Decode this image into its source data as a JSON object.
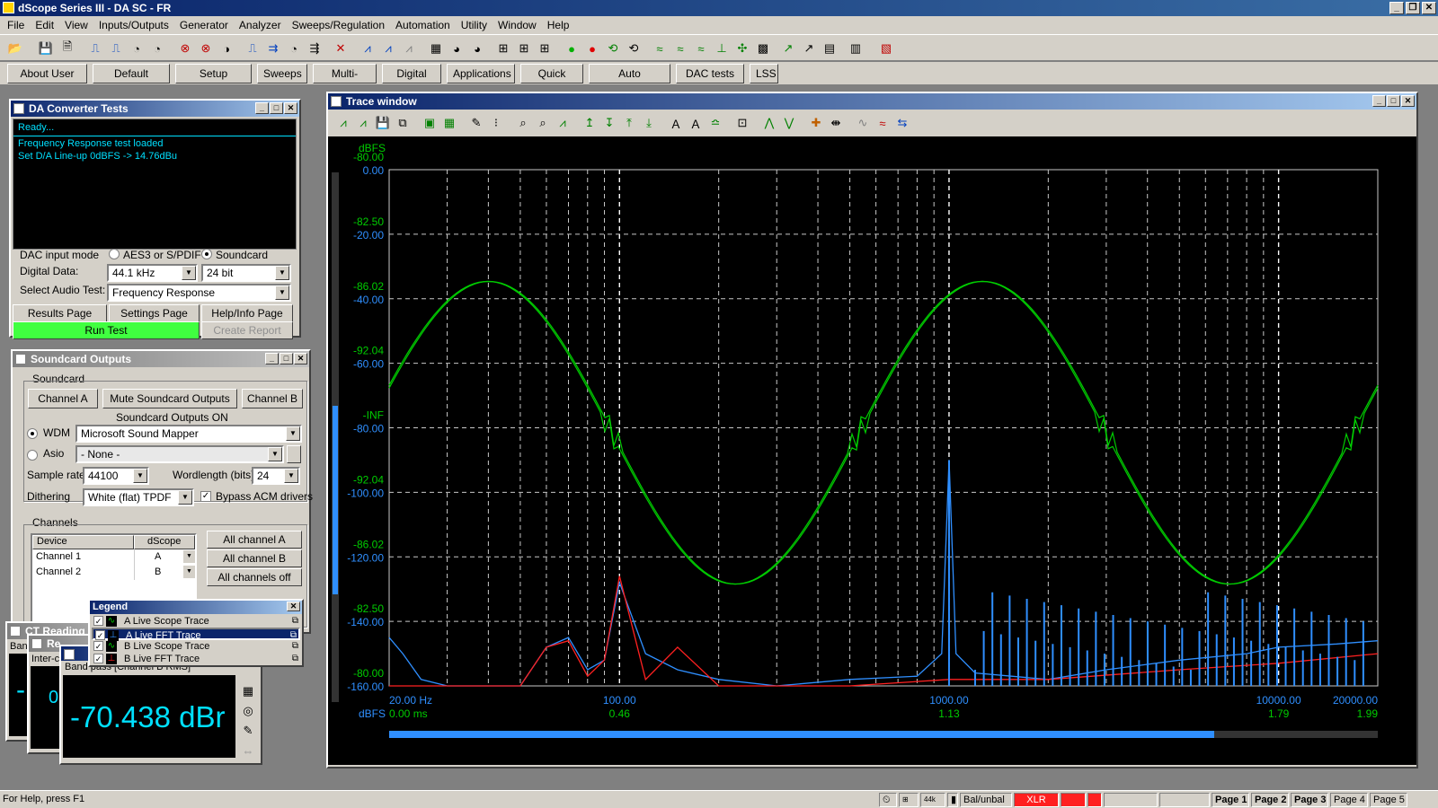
{
  "app": {
    "title": "dScope Series III - DA SC - FR"
  },
  "menu": [
    "File",
    "Edit",
    "View",
    "Inputs/Outputs",
    "Generator",
    "Analyzer",
    "Sweeps/Regulation",
    "Automation",
    "Utility",
    "Window",
    "Help"
  ],
  "user_bar": [
    "About User Bar",
    "Default Config",
    "Setup Wizard",
    "Sweeps",
    "Multi-tones",
    "Digital I/O",
    "Applications",
    "Quick Tour",
    "Auto Sequence",
    "DAC tests",
    "LSS"
  ],
  "da_panel": {
    "title": "DA Converter Tests",
    "log": [
      "Ready...",
      "Frequency Response test loaded",
      "Set D/A Line-up 0dBFS -> 14.76dBu"
    ],
    "dac_input_mode_label": "DAC input mode",
    "mode_options": [
      "AES3 or S/PDIF",
      "Soundcard"
    ],
    "mode_selected": "Soundcard",
    "digital_data_label": "Digital Data:",
    "sample_rate": "44.1 kHz",
    "bit_depth": "24 bit",
    "select_test_label": "Select Audio Test:",
    "test": "Frequency Response",
    "buttons": [
      "Results Page",
      "Settings Page",
      "Help/Info Page"
    ],
    "run": "Run Test",
    "report": "Create Report"
  },
  "sc_panel": {
    "title": "Soundcard Outputs",
    "group": "Soundcard",
    "channel_a": "Channel A",
    "mute": "Mute Soundcard Outputs",
    "channel_b": "Channel B",
    "status": "Soundcard Outputs ON",
    "wdm_label": "WDM",
    "wdm_value": "Microsoft Sound Mapper",
    "asio_label": "Asio",
    "asio_value": "- None -",
    "sample_rate_label": "Sample rate",
    "sample_rate": "44100",
    "wordlength_label": "Wordlength (bits)",
    "wordlength": "24",
    "dither_label": "Dithering",
    "dither": "White (flat) TPDF",
    "bypass": "Bypass ACM drivers",
    "channels_label": "Channels",
    "col_device": "Device",
    "col_dscope": "dScope",
    "rows": [
      {
        "device": "Channel 1",
        "dscope": "A"
      },
      {
        "device": "Channel 2",
        "dscope": "B"
      }
    ],
    "all_a": "All channel A",
    "all_b": "All channel B",
    "all_off": "All channels off"
  },
  "legend": {
    "title": "Legend",
    "items": [
      {
        "label": "A  Live Scope Trace",
        "color": "#00cc00",
        "selected": false
      },
      {
        "label": "A  Live FFT Trace",
        "color": "#2f8fff",
        "selected": true
      },
      {
        "label": "B  Live Scope Trace",
        "color": "#00cc00",
        "selected": false
      },
      {
        "label": "B  Live FFT Trace",
        "color": "#ff2020",
        "selected": false
      }
    ]
  },
  "readings": {
    "back1_title": "CT Reading",
    "back1_sub": "Ban",
    "back1_value": "-",
    "back2_title": "Re",
    "back2_sub": "Inter-c",
    "back2_value": "0",
    "front_sub": "Band pass [Channel B RMS]",
    "value": "-70.438 dBr"
  },
  "trace": {
    "title": "Trace window",
    "left_unit_top": "dBFS",
    "left_unit_bottom": "dBFS",
    "left_green_ticks": [
      "-80.00",
      "-82.50",
      "-86.02",
      "-92.04",
      "-INF",
      "-92.04",
      "-86.02",
      "-82.50",
      "-80.00"
    ],
    "left_blue_ticks": [
      "0.00",
      "-20.00",
      "-40.00",
      "-60.00",
      "-80.00",
      "-100.00",
      "-120.00",
      "-140.00",
      "-160.00"
    ],
    "x_freq_labels": [
      "20.00 Hz",
      "100.00",
      "1000.00",
      "10000.00",
      "20000.00"
    ],
    "x_time_labels": [
      "0.00 ms",
      "0.46",
      "1.13",
      "1.79",
      "1.99"
    ]
  },
  "chart_data": {
    "type": "line",
    "x_scale": "log",
    "xlim": [
      20,
      20000
    ],
    "ylim": [
      -160,
      0
    ],
    "ylabel": "dBFS",
    "series": [
      {
        "name": "A Live FFT Trace",
        "color": "#2f8fff",
        "x": [
          20,
          22,
          25,
          30,
          40,
          50,
          60,
          70,
          80,
          90,
          100,
          120,
          150,
          200,
          300,
          500,
          800,
          950,
          1000,
          1050,
          1200,
          2000,
          3000,
          5000,
          8000,
          10000,
          15000,
          20000
        ],
        "y": [
          -145,
          -150,
          -158,
          -160,
          -160,
          -160,
          -148,
          -145,
          -155,
          -152,
          -128,
          -150,
          -155,
          -158,
          -160,
          -158,
          -157,
          -150,
          -90,
          -150,
          -156,
          -158,
          -155,
          -152,
          -150,
          -148,
          -147,
          -146
        ]
      },
      {
        "name": "B Live FFT Trace",
        "color": "#ff2020",
        "x": [
          20,
          30,
          40,
          50,
          60,
          70,
          80,
          90,
          100,
          120,
          150,
          200,
          300,
          500,
          1000,
          2000,
          5000,
          10000,
          20000
        ],
        "y": [
          -160,
          -160,
          -160,
          -160,
          -148,
          -146,
          -157,
          -152,
          -126,
          -158,
          -148,
          -160,
          -160,
          -160,
          -158,
          -158,
          -155,
          -153,
          -150
        ]
      }
    ]
  }
}
